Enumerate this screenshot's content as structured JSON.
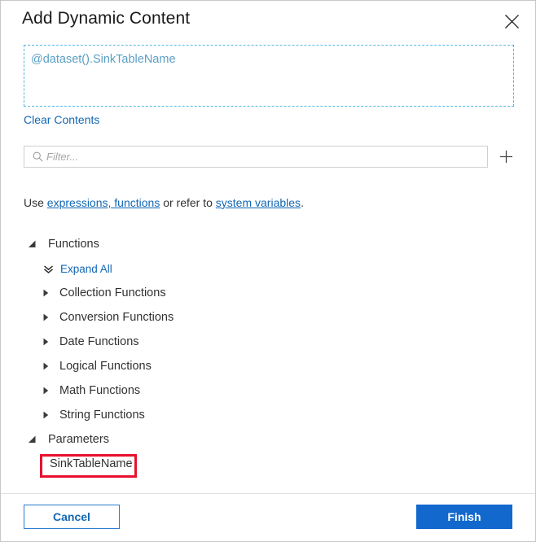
{
  "dialog": {
    "title": "Add Dynamic Content",
    "close_icon": "close-icon"
  },
  "expression": {
    "value": "@dataset().SinkTableName",
    "clear_label": "Clear Contents",
    "text_color": "#5a9fc4",
    "border_color": "#52b6e4"
  },
  "filter": {
    "placeholder": "Filter...",
    "value": "",
    "search_icon": "search-icon",
    "add_icon": "plus-icon"
  },
  "helper": {
    "prefix": "Use ",
    "link1": "expressions, functions",
    "middle": " or refer to ",
    "link2": "system variables",
    "suffix": ".",
    "link_color": "#1267b5"
  },
  "tree": {
    "functions_group": {
      "label": "Functions",
      "expanded": true,
      "expand_all_label": "Expand All",
      "expand_all_icon": "double-chevron-down-icon",
      "items": [
        {
          "label": "Collection Functions",
          "expanded": false
        },
        {
          "label": "Conversion Functions",
          "expanded": false
        },
        {
          "label": "Date Functions",
          "expanded": false
        },
        {
          "label": "Logical Functions",
          "expanded": false
        },
        {
          "label": "Math Functions",
          "expanded": false
        },
        {
          "label": "String Functions",
          "expanded": false
        }
      ]
    },
    "parameters_group": {
      "label": "Parameters",
      "expanded": true,
      "items": [
        {
          "label": "SinkTableName",
          "highlighted": true
        }
      ]
    }
  },
  "annotation": {
    "highlight_color": "#e8112d"
  },
  "footer": {
    "cancel_label": "Cancel",
    "finish_label": "Finish",
    "primary_color": "#1268cd"
  }
}
